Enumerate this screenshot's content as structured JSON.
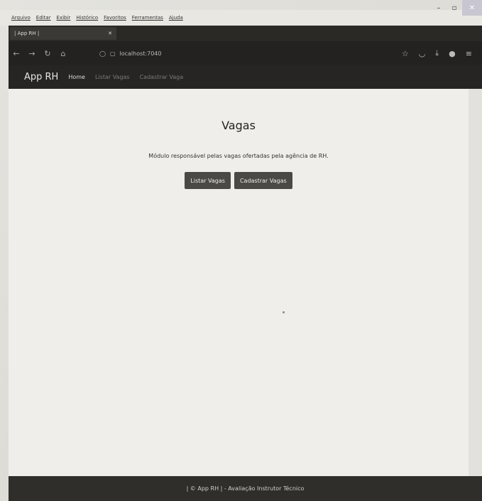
{
  "browser": {
    "menu": [
      "Arquivo",
      "Editar",
      "Exibir",
      "Histórico",
      "Favoritos",
      "Ferramentas",
      "Ajuda"
    ],
    "tab_title": "| App RH |",
    "url": "localhost:7040",
    "icons": {
      "back": "arrow-left-icon",
      "forward": "arrow-right-icon",
      "reload": "reload-icon",
      "home": "home-icon",
      "bookmark": "star-icon",
      "pocket": "shield-icon",
      "download": "download-icon",
      "account": "account-icon",
      "menu": "hamburger-icon"
    }
  },
  "app": {
    "brand": "App RH",
    "nav": {
      "home": "Home",
      "list": "Listar Vagas",
      "create": "Cadastrar Vaga"
    }
  },
  "main": {
    "title": "Vagas",
    "lead": "Módulo responsável pelas vagas ofertadas pela agência de RH.",
    "buttons": {
      "list": "Listar Vagas",
      "create": "Cadastrar Vagas"
    }
  },
  "footer": {
    "text": "| © App RH | - Avaliação Instrutor Técnico"
  },
  "colors": {
    "navbar": "#262523",
    "button": "#4a4945",
    "footer": "#2f2e2b"
  }
}
